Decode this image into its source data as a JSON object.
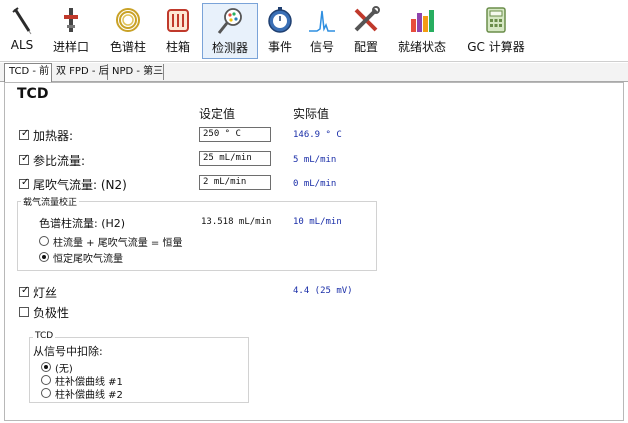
{
  "toolbar": {
    "items": [
      {
        "label": "ALS",
        "icon": "syringe-icon"
      },
      {
        "label": "进样口",
        "icon": "inlet-icon"
      },
      {
        "label": "色谱柱",
        "icon": "column-coil-icon"
      },
      {
        "label": "柱箱",
        "icon": "oven-icon"
      },
      {
        "label": "检测器",
        "icon": "detector-icon",
        "active": true
      },
      {
        "label": "事件",
        "icon": "stopwatch-icon"
      },
      {
        "label": "信号",
        "icon": "signal-peak-icon"
      },
      {
        "label": "配置",
        "icon": "tools-icon"
      },
      {
        "label": "就绪状态",
        "icon": "status-bars-icon"
      },
      {
        "label": "GC 计算器",
        "icon": "calculator-icon"
      }
    ]
  },
  "tabs": [
    "TCD - 前",
    "双 FPD - 后",
    "NPD - 第三"
  ],
  "panel": {
    "title": "TCD",
    "col_setpoint": "设定值",
    "col_actual": "实际值",
    "heater": {
      "label": "加热器:",
      "checked": true,
      "setpoint": "250 ° C",
      "actual": "146.9 ° C"
    },
    "ref_flow": {
      "label": "参比流量:",
      "checked": true,
      "setpoint": "25 mL/min",
      "actual": "5 mL/min"
    },
    "makeup_flow": {
      "label": "尾吹气流量: (N2)",
      "checked": true,
      "setpoint": "2 mL/min",
      "actual": "0 mL/min"
    },
    "carrier_group": {
      "caption": "载气流量校正",
      "column_flow_label": "色谱柱流量: (H2)",
      "column_flow_setpoint": "13.518 mL/min",
      "column_flow_actual": "10 mL/min",
      "option1": "柱流量 + 尾吹气流量 = 恒量",
      "option2": "恒定尾吹气流量",
      "selected": 2
    },
    "filament": {
      "label": "灯丝",
      "checked": true,
      "actual": "4.4 (25 mV)"
    },
    "negative": {
      "label": "负极性",
      "checked": false
    },
    "subtract_group": {
      "caption": "TCD",
      "label": "从信号中扣除:",
      "options": [
        "(无)",
        "柱补偿曲线 #1",
        "柱补偿曲线 #2"
      ],
      "selected": 0
    }
  },
  "colors": {
    "actual_value": "#1a2ea8",
    "active_tab_border": "#7aa3d8"
  }
}
